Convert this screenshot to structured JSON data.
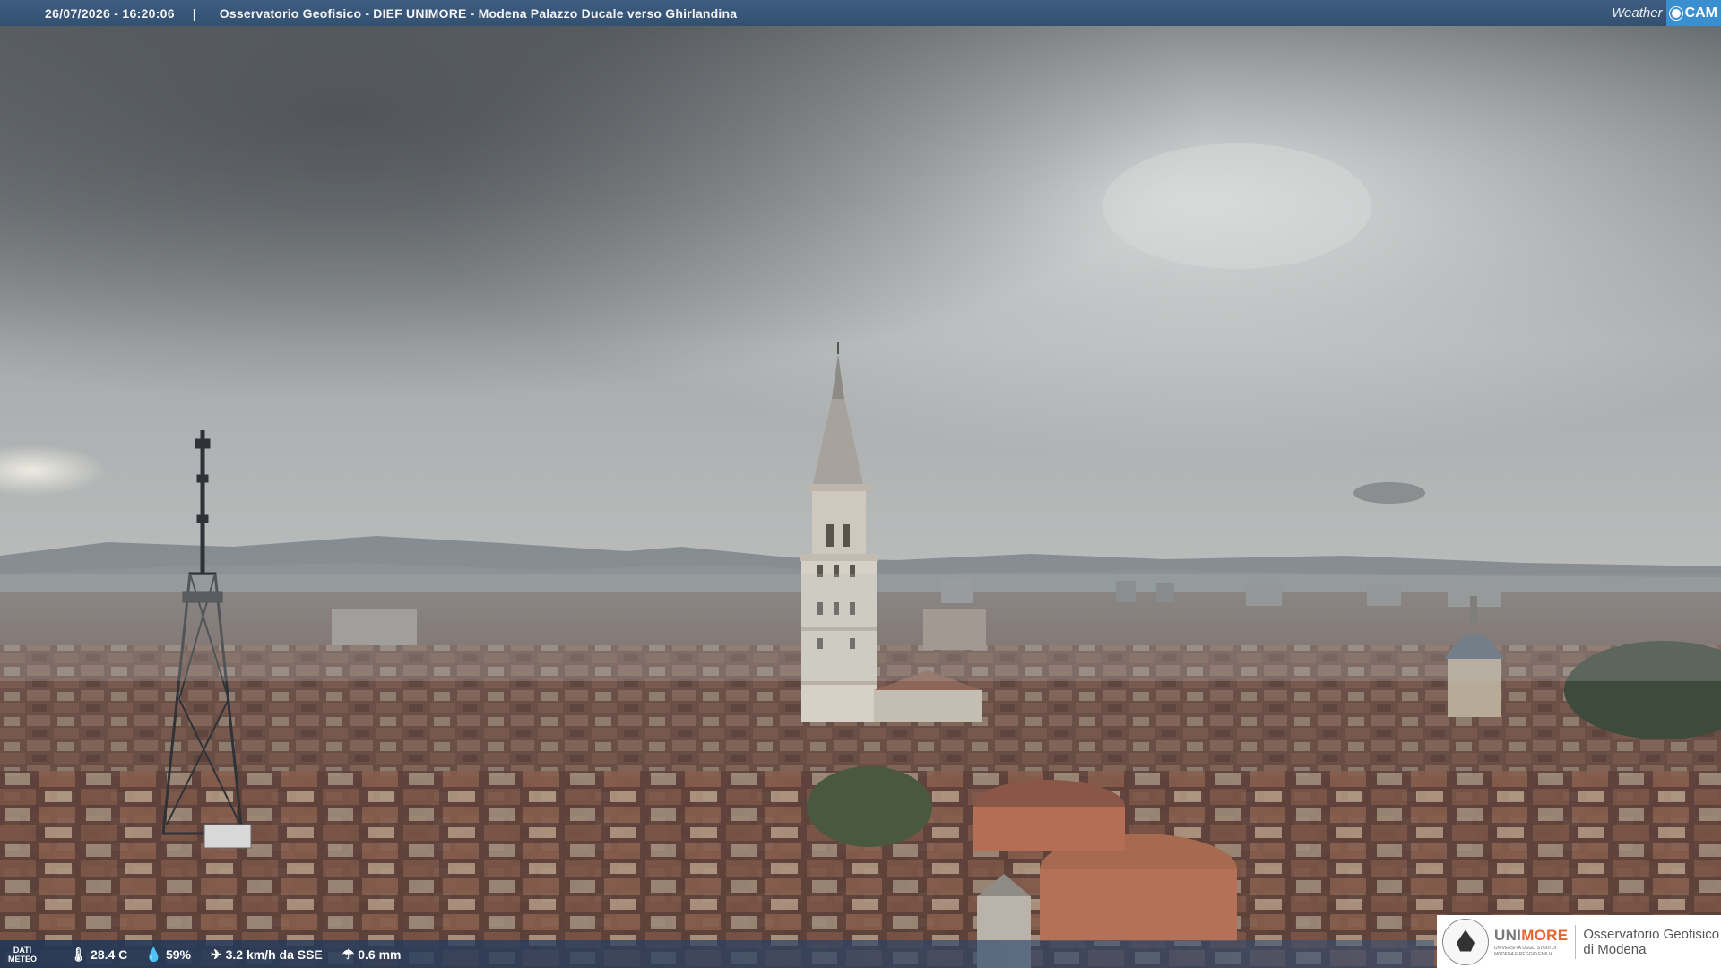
{
  "header": {
    "datetime": "26/07/2026 - 16:20:06",
    "separator": "|",
    "title": "Osservatorio Geofisico - DIEF UNIMORE - Modena Palazzo Ducale verso Ghirlandina",
    "brand_weather": "Weather",
    "brand_cam": "CAM"
  },
  "weather": {
    "label_line1": "DATI",
    "label_line2": "METEO",
    "temperature": "28.4 C",
    "humidity": "59%",
    "wind": "3.2 km/h da SSE",
    "rain": "0.6 mm",
    "icons": [
      "thermometer-icon",
      "humidity-icon",
      "wind-icon",
      "rain-gauge-icon"
    ]
  },
  "logo": {
    "uni_part1": "UNI",
    "uni_part2": "MORE",
    "uni_sub_line1": "UNIVERSITÀ DEGLI STUDI DI",
    "uni_sub_line2": "MODENA E REGGIO EMILIA",
    "obs_line1": "Osservatorio Geofisico",
    "obs_line2": "di Modena"
  },
  "colors": {
    "bar": "#3a5a80",
    "brand_accent": "#3a8fd0",
    "unimore_orange": "#e8642d"
  }
}
